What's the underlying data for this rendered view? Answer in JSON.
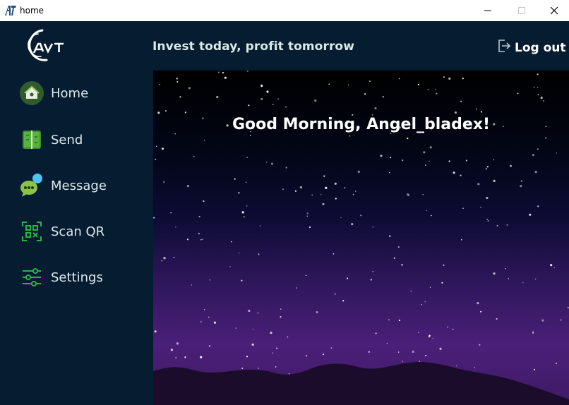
{
  "window": {
    "title": "home"
  },
  "header": {
    "tagline": "Invest today, profit tomorrow",
    "logout_label": "Log out"
  },
  "sidebar": {
    "items": [
      {
        "label": "Home",
        "icon": "home-icon"
      },
      {
        "label": "Send",
        "icon": "send-icon"
      },
      {
        "label": "Message",
        "icon": "message-icon"
      },
      {
        "label": "Scan QR",
        "icon": "qr-scan-icon"
      },
      {
        "label": "Settings",
        "icon": "settings-sliders-icon"
      }
    ]
  },
  "main": {
    "greeting": "Good Morning, Angel_bladex!"
  },
  "colors": {
    "sidebar_bg": "#061c30",
    "accent_green": "#2bb34a",
    "sky_top": "#000000",
    "sky_bottom": "#4a1f78"
  }
}
